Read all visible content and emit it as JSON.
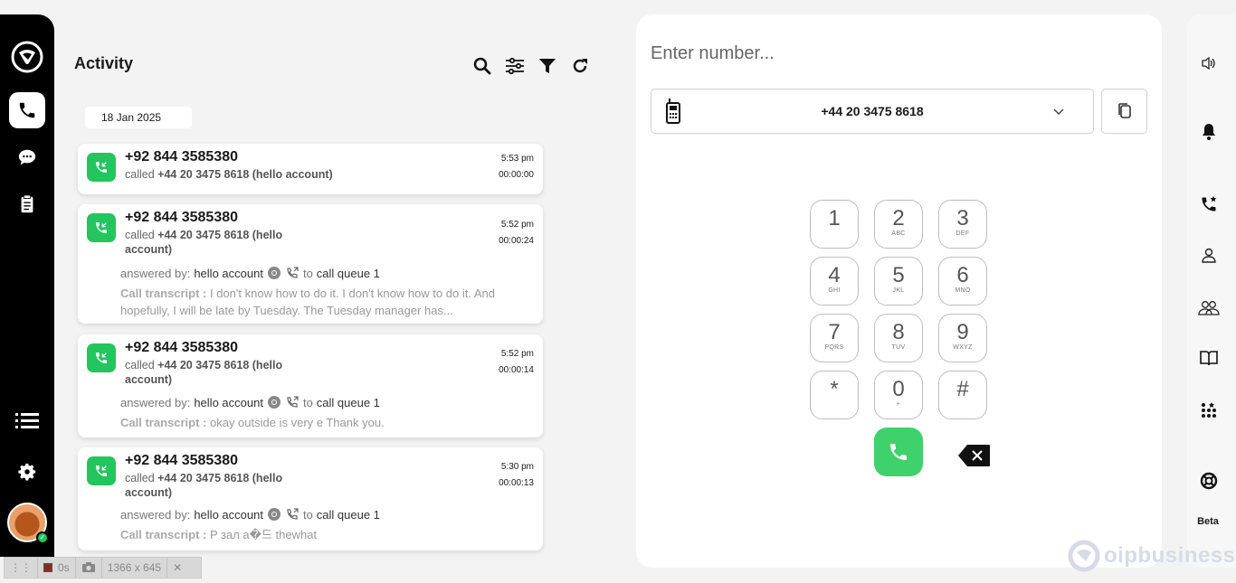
{
  "activity": {
    "title": "Activity",
    "date": "18 Jan 2025",
    "cards": [
      {
        "number": "+92 844 3585380",
        "called_prefix": "called",
        "called_target": "+44 20 3475 8618 (hello account)",
        "time": "5:53 pm",
        "duration": "00:00:00"
      },
      {
        "number": "+92 844 3585380",
        "called_prefix": "called",
        "called_target": "+44 20 3475 8618 (hello account)",
        "time": "5:52 pm",
        "duration": "00:00:24",
        "answered_label": "answered by:",
        "answered_by": "hello account",
        "to_label": "to",
        "queue": "call queue 1",
        "transcript_label": "Call transcript :",
        "transcript": "I don't know how to do it. I don't know how to do it. And hopefully, I will be late by Tuesday. The Tuesday manager has..."
      },
      {
        "number": "+92 844 3585380",
        "called_prefix": "called",
        "called_target": "+44 20 3475 8618 (hello account)",
        "time": "5:52 pm",
        "duration": "00:00:14",
        "answered_label": "answered by:",
        "answered_by": "hello account",
        "to_label": "to",
        "queue": "call queue 1",
        "transcript_label": "Call transcript :",
        "transcript": "okay outside is very e Thank you."
      },
      {
        "number": "+92 844 3585380",
        "called_prefix": "called",
        "called_target": "+44 20 3475 8618 (hello account)",
        "time": "5:30 pm",
        "duration": "00:00:13",
        "answered_label": "answered by:",
        "answered_by": "hello account",
        "to_label": "to",
        "queue": "call queue 1",
        "transcript_label": "Call transcript :",
        "transcript": "P зал а�드 thewhat"
      }
    ]
  },
  "dialer": {
    "placeholder": "Enter number...",
    "caller_id": "+44 20 3475 8618",
    "keys": [
      {
        "d": "1",
        "l": ""
      },
      {
        "d": "2",
        "l": "ABC"
      },
      {
        "d": "3",
        "l": "DEF"
      },
      {
        "d": "4",
        "l": "GHI"
      },
      {
        "d": "5",
        "l": "JKL"
      },
      {
        "d": "6",
        "l": "MNO"
      },
      {
        "d": "7",
        "l": "PQRS"
      },
      {
        "d": "8",
        "l": "TUV"
      },
      {
        "d": "9",
        "l": "WXYZ"
      },
      {
        "d": "*",
        "l": ""
      },
      {
        "d": "0",
        "l": "+"
      },
      {
        "d": "#",
        "l": ""
      }
    ]
  },
  "right_rail": {
    "beta": "Beta"
  },
  "brand": {
    "text": "oipbusiness"
  },
  "recorder": {
    "time": "0s",
    "size": "1366 x 645"
  },
  "colors": {
    "accent_green": "#22c55e",
    "rail": "#000000"
  }
}
